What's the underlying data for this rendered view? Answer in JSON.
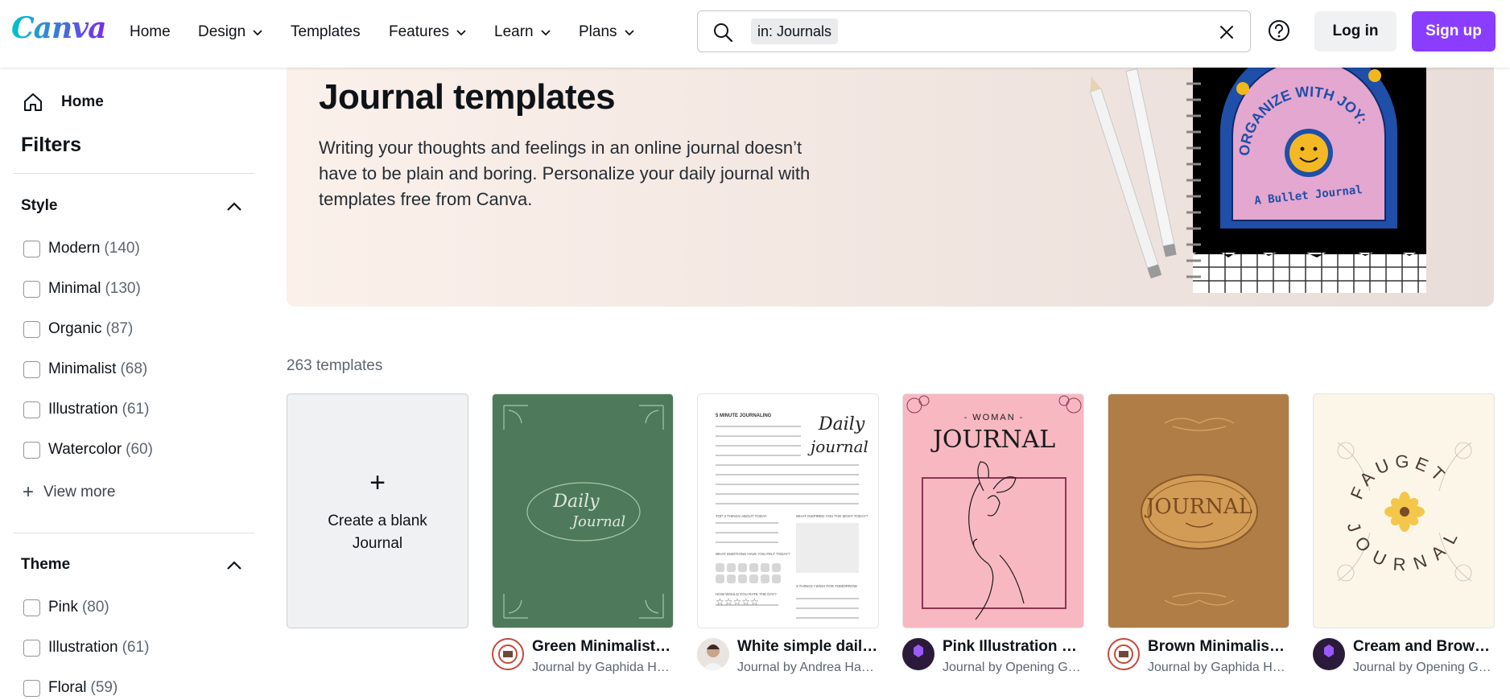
{
  "header": {
    "logo": "Canva",
    "nav": [
      {
        "label": "Home",
        "dropdown": false
      },
      {
        "label": "Design",
        "dropdown": true
      },
      {
        "label": "Templates",
        "dropdown": false
      },
      {
        "label": "Features",
        "dropdown": true
      },
      {
        "label": "Learn",
        "dropdown": true
      },
      {
        "label": "Plans",
        "dropdown": true
      }
    ],
    "search": {
      "chip": "in: Journals",
      "value": ""
    },
    "login_label": "Log in",
    "signup_label": "Sign up",
    "accent": "#8b3dff"
  },
  "sidebar": {
    "home_label": "Home",
    "filters_title": "Filters",
    "style": {
      "title": "Style",
      "items": [
        {
          "label": "Modern",
          "count": "(140)"
        },
        {
          "label": "Minimal",
          "count": "(130)"
        },
        {
          "label": "Organic",
          "count": "(87)"
        },
        {
          "label": "Minimalist",
          "count": "(68)"
        },
        {
          "label": "Illustration",
          "count": "(61)"
        },
        {
          "label": "Watercolor",
          "count": "(60)"
        }
      ],
      "view_more": "View more"
    },
    "theme": {
      "title": "Theme",
      "items": [
        {
          "label": "Pink",
          "count": "(80)"
        },
        {
          "label": "Illustration",
          "count": "(61)"
        },
        {
          "label": "Floral",
          "count": "(59)"
        }
      ]
    }
  },
  "hero": {
    "title": "Journal templates",
    "description": "Writing your thoughts and feelings in an online journal doesn’t have to be plain and boring. Personalize your daily journal with templates free from Canva.",
    "art": {
      "line1": "ORGANIZE WITH JOY:",
      "line2": "A Bullet Journal"
    }
  },
  "results": {
    "count_label": "263 templates",
    "blank_label": "Create a blank Journal",
    "templates": [
      {
        "title": "Green Minimalist Daily Journal",
        "subtitle": "Journal by Gaphida Hype",
        "cover_text": [
          "Daily",
          "Journal"
        ],
        "cover_color": "#4e7a5b"
      },
      {
        "title": "White simple daily journal",
        "subtitle": "Journal by Andrea Hanes",
        "cover_text": [
          "5 MINUTE JOURNALING",
          "Daily",
          "journal",
          "TOP 3 THINGS ABOUT TODAY",
          "WHAT INSPIRED YOU THE MOST TODAY?",
          "WHAT EMOTIONS HAVE YOU FELT TODAY?",
          "3 THINGS I WISH FOR TOMORROW",
          "HOW WOULD YOU RATE THE DAY?"
        ],
        "cover_color": "#ffffff"
      },
      {
        "title": "Pink Illustration Woman Journal",
        "subtitle": "Journal by Opening Gate",
        "cover_text": [
          "- WOMAN -",
          "JOURNAL"
        ],
        "cover_color": "#f8b8c2"
      },
      {
        "title": "Brown Minimalist Journal",
        "subtitle": "Journal by Gaphida Hype",
        "cover_text": [
          "JOURNAL"
        ],
        "cover_color": "#b07d47"
      },
      {
        "title": "Cream and Brown Journal",
        "subtitle": "Journal by Opening Gate",
        "cover_text": [
          "FAUGET",
          "JOURNAL"
        ],
        "cover_color": "#fcf6e9"
      }
    ]
  }
}
